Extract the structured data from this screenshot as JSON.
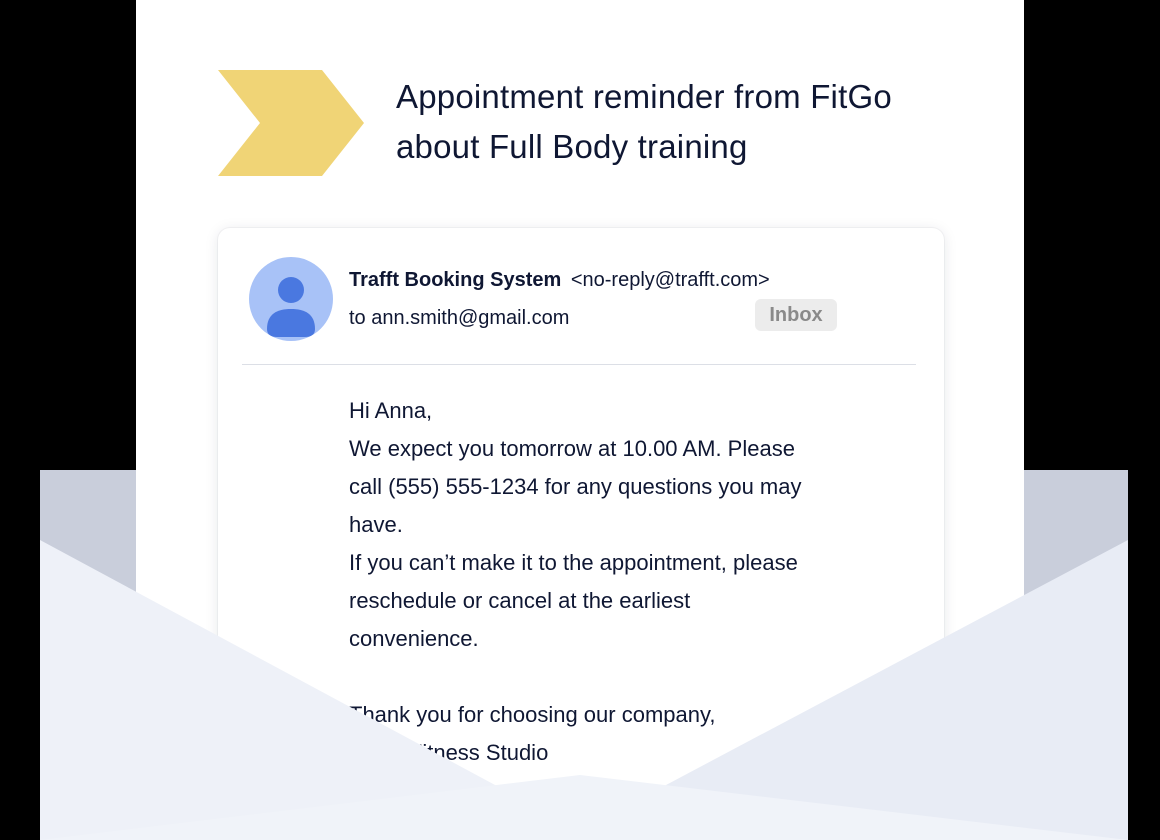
{
  "headline": {
    "line1": "Appointment reminder from FitGo",
    "line2": "about Full Body training"
  },
  "email": {
    "sender_name": "Trafft Booking System",
    "sender_address": "<no-reply@trafft.com>",
    "to_line": "to ann.smith@gmail.com",
    "label": "Inbox",
    "body": {
      "greeting": "Hi Anna,",
      "line1": "We expect you tomorrow at 10.00 AM. Please",
      "line2": "call (555) 555-1234 for any questions you may",
      "line3": "have.",
      "line4": "If you can’t make it to the appointment, please",
      "line5": "reschedule or cancel at the earliest",
      "line6": "convenience.",
      "signoff": "Thank you for choosing our company,",
      "signature": "FitGo Fitness Studio"
    }
  },
  "colors": {
    "arrow": "#f0d476",
    "avatar_bg": "#a8c2f7",
    "avatar_fg": "#4a78e0",
    "text": "#0f1733",
    "envelope_front": "#eef1f8",
    "envelope_back": "#c9cedb"
  },
  "icons": {
    "logo": "chevron-arrow-icon",
    "avatar": "user-avatar-icon"
  }
}
